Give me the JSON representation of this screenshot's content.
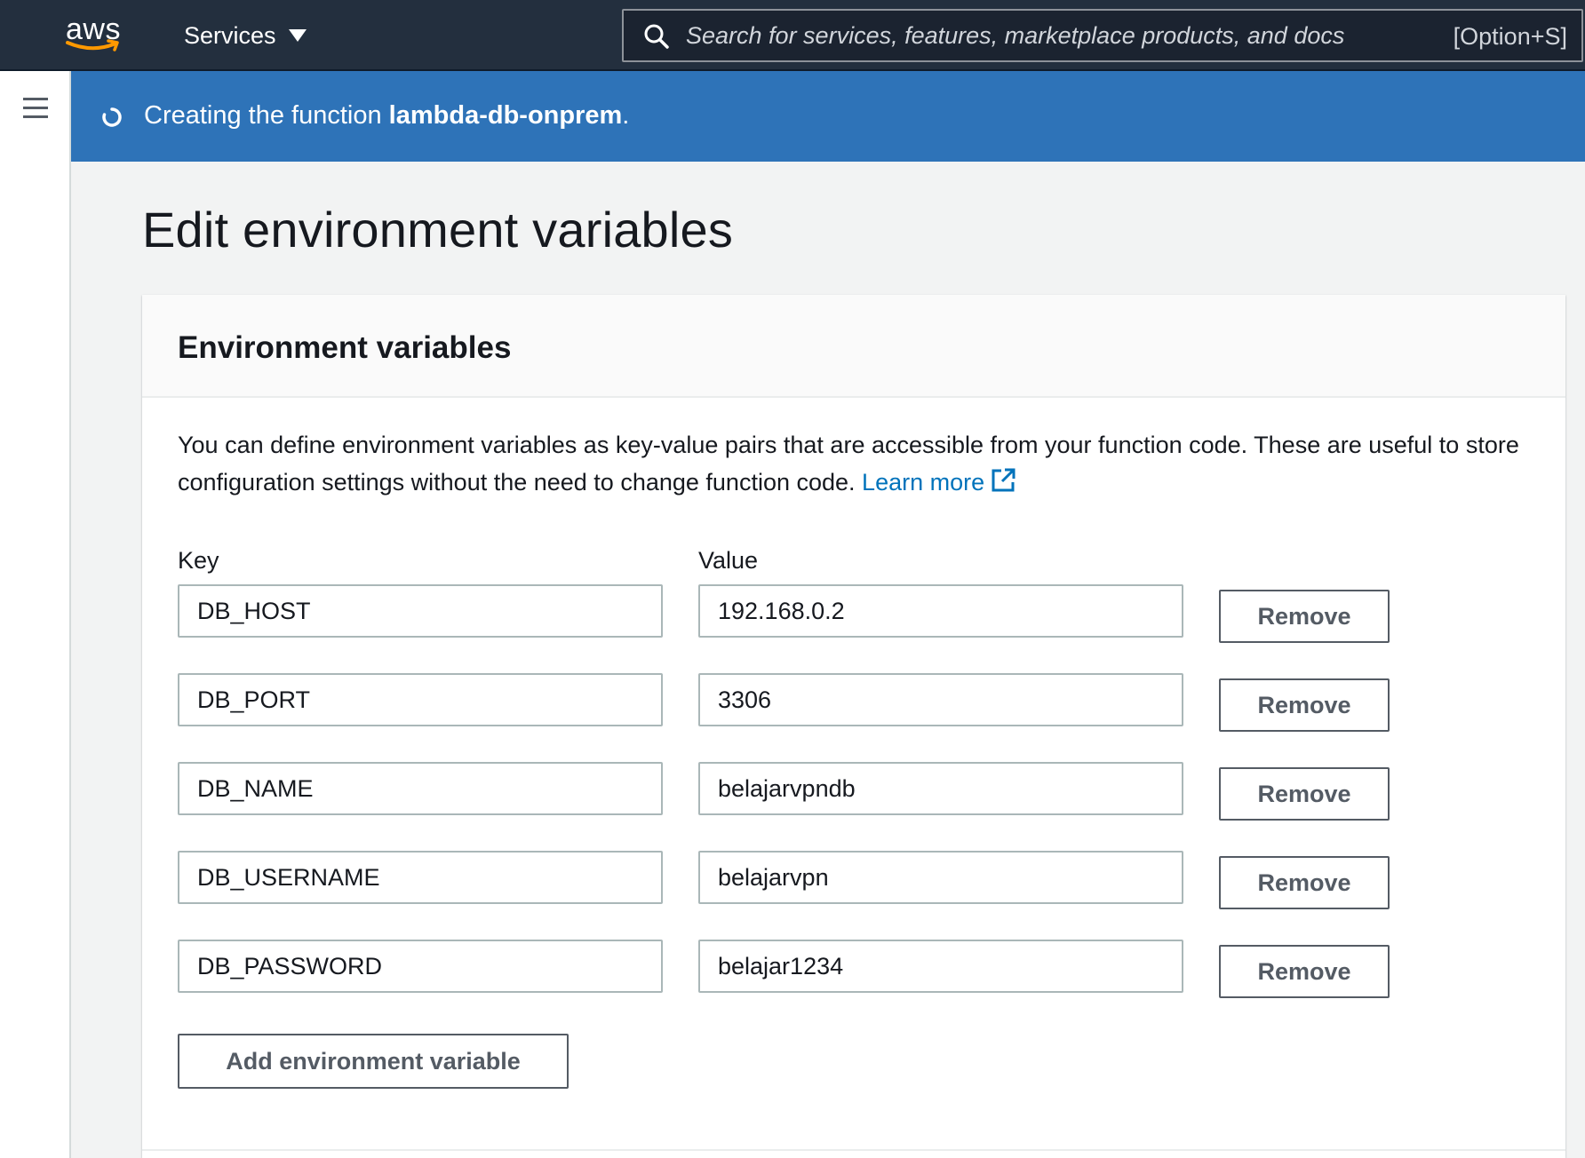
{
  "topnav": {
    "logo_text": "aws",
    "services_label": "Services",
    "search_placeholder": "Search for services, features, marketplace products, and docs",
    "search_shortcut": "[Option+S]"
  },
  "flash": {
    "prefix": "Creating the function ",
    "function_name": "lambda-db-onprem",
    "suffix": ".",
    "color": "#2e73b8"
  },
  "page": {
    "title": "Edit environment variables"
  },
  "container": {
    "header": "Environment variables",
    "description": "You can define environment variables as key-value pairs that are accessible from your function code. These are useful to store configuration settings without the need to change function code.",
    "learn_more": "Learn more",
    "key_label": "Key",
    "value_label": "Value",
    "remove_label": "Remove",
    "add_label": "Add environment variable",
    "variables": [
      {
        "key": "DB_HOST",
        "value": "192.168.0.2"
      },
      {
        "key": "DB_PORT",
        "value": "3306"
      },
      {
        "key": "DB_NAME",
        "value": "belajarvpndb"
      },
      {
        "key": "DB_USERNAME",
        "value": "belajarvpn"
      },
      {
        "key": "DB_PASSWORD",
        "value": "belajar1234"
      }
    ]
  },
  "colors": {
    "nav_bg": "#232f3e",
    "link": "#0073bb",
    "logo_smile": "#ff9900"
  }
}
